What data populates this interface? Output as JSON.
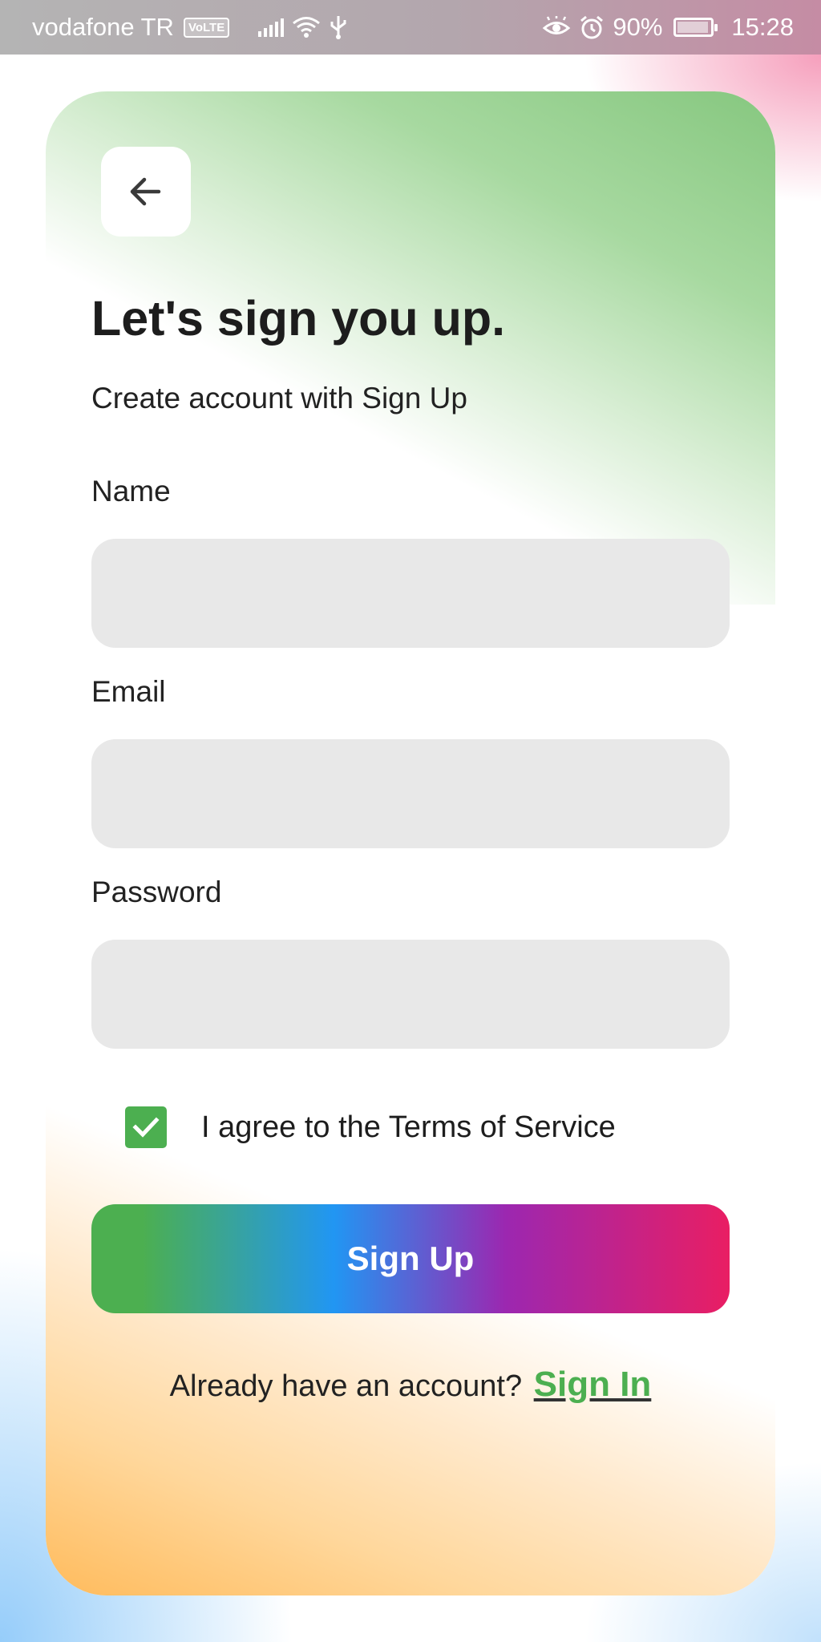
{
  "status_bar": {
    "carrier": "vodafone TR",
    "volte": "VoLTE",
    "battery_percent": "90%",
    "time": "15:28",
    "icons": [
      "volte-icon",
      "signal-icon",
      "wifi-icon",
      "usb-icon",
      "eye-icon",
      "alarm-icon",
      "battery-icon"
    ]
  },
  "header": {
    "back_icon": "arrow-left-icon",
    "title": "Let's sign you up.",
    "subtitle": "Create account with Sign Up"
  },
  "form": {
    "name": {
      "label": "Name",
      "value": "",
      "placeholder": ""
    },
    "email": {
      "label": "Email",
      "value": "",
      "placeholder": ""
    },
    "password": {
      "label": "Password",
      "value": "",
      "placeholder": ""
    },
    "terms": {
      "label": "I agree to the Terms of Service",
      "checked": true
    },
    "submit_label": "Sign Up"
  },
  "footer": {
    "prompt": "Already have an account?",
    "link_label": "Sign In"
  },
  "colors": {
    "accent_green": "#4caf50",
    "gradient": [
      "#4caf50",
      "#2196f3",
      "#9c27b0",
      "#e91e63"
    ],
    "input_bg": "#e8e8e8",
    "text_dark": "#1d1d1d"
  }
}
